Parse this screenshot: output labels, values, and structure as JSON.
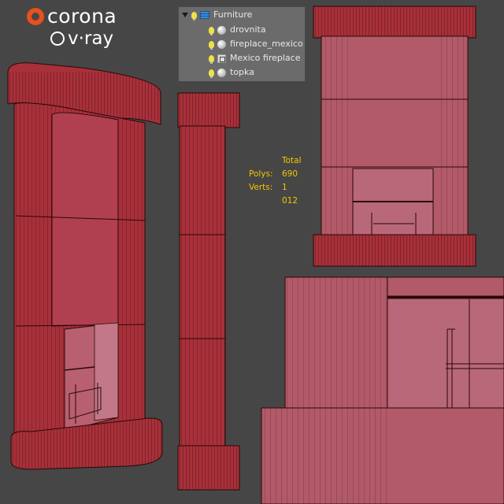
{
  "logos": {
    "corona_text": "corona",
    "vray_text": "v·ray"
  },
  "scene_explorer": {
    "layer": {
      "name": "Furniture",
      "icon": "layers-icon"
    },
    "objects": [
      {
        "name": "drovnita",
        "icon": "sphere-icon"
      },
      {
        "name": "fireplace_mexico",
        "icon": "sphere-icon"
      },
      {
        "name": "Mexico fireplace",
        "icon": "group-icon"
      },
      {
        "name": "topka",
        "icon": "sphere-icon"
      }
    ]
  },
  "stats": {
    "header": "Total",
    "polys_label": "Polys:",
    "polys_value": "690",
    "verts_label": "Verts:",
    "verts_value": "1 012"
  },
  "colors": {
    "background": "#464646",
    "model_fill": "#a8303a",
    "model_light": "#b25a68",
    "wire": "#2a0808",
    "stats_text": "#f2c600"
  }
}
